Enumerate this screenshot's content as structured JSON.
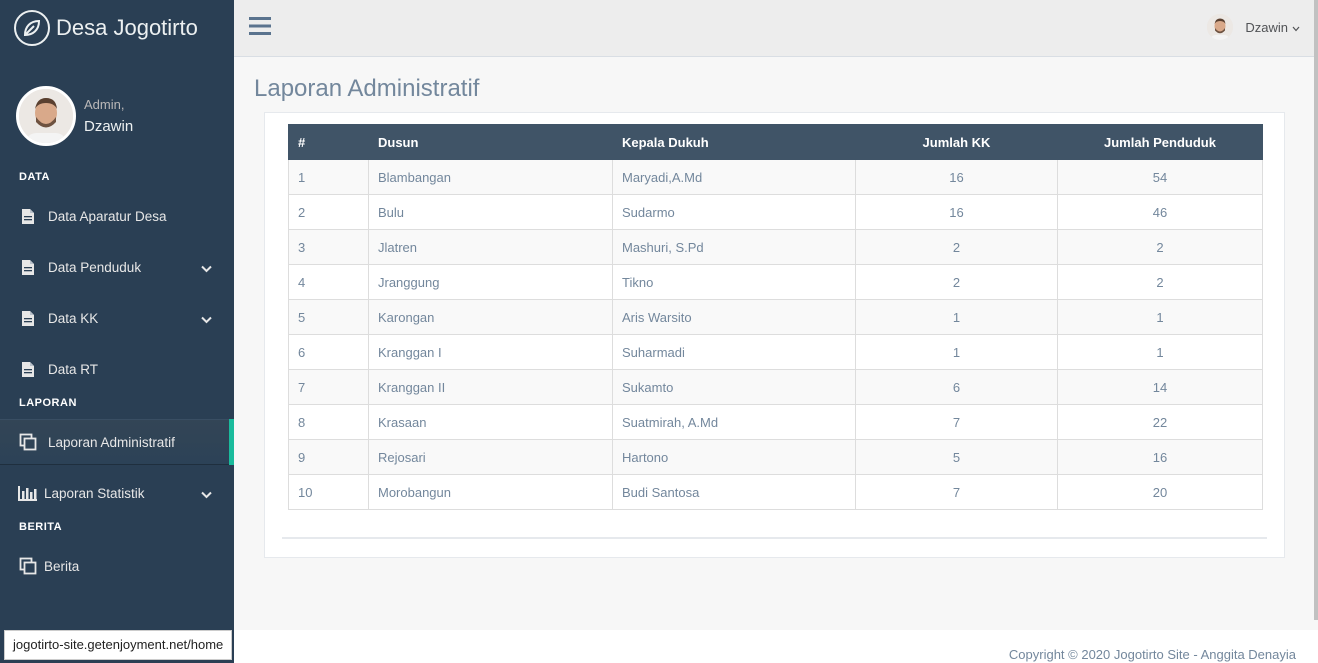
{
  "brand": {
    "title": "Desa Jogotirto"
  },
  "profile": {
    "greeting": "Admin,",
    "name": "Dzawin"
  },
  "sidebar": {
    "sections": [
      "DATA",
      "LAPORAN",
      "BERITA"
    ],
    "items": [
      {
        "label": "Data Aparatur Desa",
        "icon": "document-icon"
      },
      {
        "label": "Data Penduduk",
        "icon": "document-icon",
        "has_submenu": true
      },
      {
        "label": "Data KK",
        "icon": "document-icon",
        "has_submenu": true
      },
      {
        "label": "Data RT",
        "icon": "document-icon"
      },
      {
        "label": "Laporan Administratif",
        "icon": "copy-icon",
        "active": true
      },
      {
        "label": "Laporan Statistik",
        "icon": "bar-chart-icon",
        "has_submenu": true
      },
      {
        "label": "Berita",
        "icon": "copy-icon"
      }
    ]
  },
  "topbar": {
    "user_name": "Dzawin"
  },
  "page": {
    "title": "Laporan Administratif"
  },
  "table": {
    "headers": [
      "#",
      "Dusun",
      "Kepala Dukuh",
      "Jumlah KK",
      "Jumlah Penduduk"
    ],
    "rows": [
      [
        "1",
        "Blambangan",
        "Maryadi,A.Md",
        "16",
        "54"
      ],
      [
        "2",
        "Bulu",
        "Sudarmo",
        "16",
        "46"
      ],
      [
        "3",
        "Jlatren",
        "Mashuri, S.Pd",
        "2",
        "2"
      ],
      [
        "4",
        "Jranggung",
        "Tikno",
        "2",
        "2"
      ],
      [
        "5",
        "Karongan",
        "Aris Warsito",
        "1",
        "1"
      ],
      [
        "6",
        "Kranggan I",
        "Suharmadi",
        "1",
        "1"
      ],
      [
        "7",
        "Kranggan II",
        "Sukamto",
        "6",
        "14"
      ],
      [
        "8",
        "Krasaan",
        "Suatmirah, A.Md",
        "7",
        "22"
      ],
      [
        "9",
        "Rejosari",
        "Hartono",
        "5",
        "16"
      ],
      [
        "10",
        "Morobangun",
        "Budi Santosa",
        "7",
        "20"
      ]
    ]
  },
  "footer": {
    "text": "Copyright © 2020 Jogotirto Site - Anggita Denayia"
  },
  "status_bar": {
    "url": "jogotirto-site.getenjoyment.net/home"
  },
  "colors": {
    "sidebar": "#2A3F54",
    "accent": "#1ABB9C",
    "table_header": "#405467"
  }
}
